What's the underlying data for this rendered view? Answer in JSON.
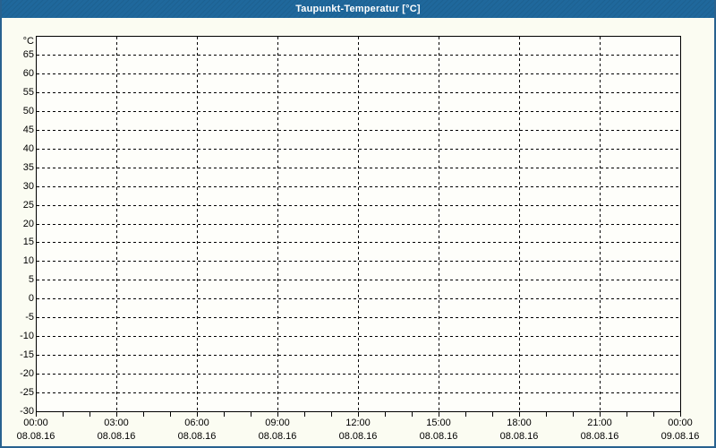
{
  "window": {
    "title": "Taupunkt-Temperatur [°C]"
  },
  "colors": {
    "titlebar_bg": "#1f689c",
    "titlebar_text": "#ffffff",
    "outer_border": "#28628f",
    "page_bg": "#fbfcf2",
    "plot_bg": "#fefefa",
    "grid_color": "#000000",
    "label_color": "#000000"
  },
  "chart_data": {
    "type": "line",
    "title": "Taupunkt-Temperatur [°C]",
    "y_unit_label": "°C",
    "ylabel": "",
    "xlabel": "",
    "ylim": [
      -30,
      70
    ],
    "y_tick_step": 5,
    "y_ticks": [
      65,
      60,
      55,
      50,
      45,
      40,
      35,
      30,
      25,
      20,
      15,
      10,
      5,
      0,
      -5,
      -10,
      -15,
      -20,
      -25,
      -30
    ],
    "x_axis": {
      "hours_span": 24,
      "major_tick_hours": 3,
      "minor_tick_hours": 1,
      "time_labels": [
        "00:00",
        "03:00",
        "06:00",
        "09:00",
        "12:00",
        "15:00",
        "18:00",
        "21:00",
        "00:00"
      ],
      "date_labels": [
        "08.08.16",
        "08.08.16",
        "08.08.16",
        "08.08.16",
        "08.08.16",
        "08.08.16",
        "08.08.16",
        "08.08.16",
        "09.08.16"
      ]
    },
    "grid": "dashed",
    "legend": "none",
    "series": []
  }
}
